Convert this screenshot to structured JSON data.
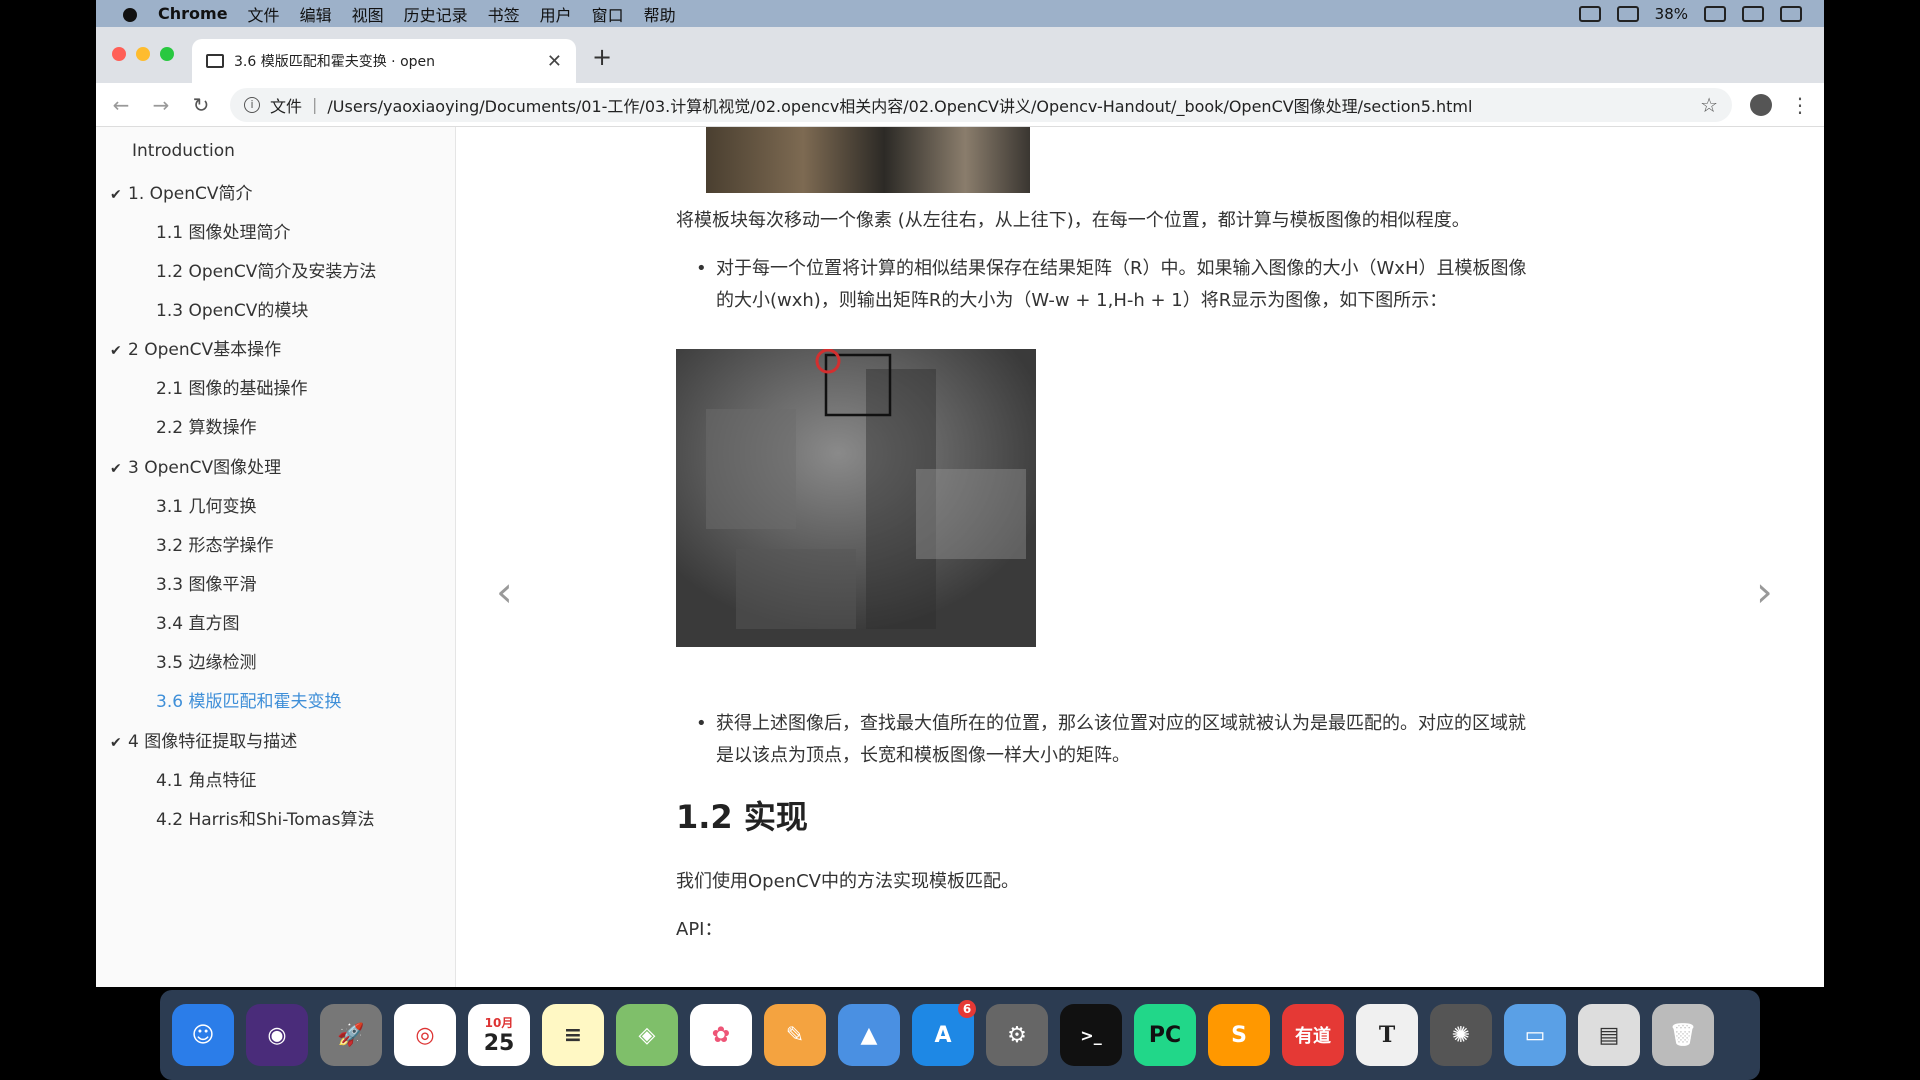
{
  "menubar": {
    "app": "Chrome",
    "items": [
      "文件",
      "编辑",
      "视图",
      "历史记录",
      "书签",
      "用户",
      "窗口",
      "帮助"
    ],
    "battery": "38%"
  },
  "browser": {
    "tab_title": "3.6 模版匹配和霍夫变换 · open",
    "url_prefix": "文件",
    "url": "/Users/yaoxiaoying/Documents/01-工作/03.计算机视觉/02.opencv相关内容/02.OpenCV讲义/Opencv-Handout/_book/OpenCV图像处理/section5.html"
  },
  "sidebar": {
    "items": [
      {
        "label": "Introduction"
      },
      {
        "label": "1. OpenCV简介",
        "expanded": true
      },
      {
        "label": "1.1 图像处理简介"
      },
      {
        "label": "1.2 OpenCV简介及安装方法"
      },
      {
        "label": "1.3 OpenCV的模块"
      },
      {
        "label": "2 OpenCV基本操作",
        "expanded": true
      },
      {
        "label": "2.1 图像的基础操作"
      },
      {
        "label": "2.2 算数操作"
      },
      {
        "label": "3 OpenCV图像处理",
        "expanded": true
      },
      {
        "label": "3.1 几何变换"
      },
      {
        "label": "3.2 形态学操作"
      },
      {
        "label": "3.3 图像平滑"
      },
      {
        "label": "3.4 直方图"
      },
      {
        "label": "3.5 边缘检测"
      },
      {
        "label": "3.6 模版匹配和霍夫变换",
        "active": true
      },
      {
        "label": "4 图像特征提取与描述",
        "expanded": true
      },
      {
        "label": "4.1 角点特征"
      },
      {
        "label": "4.2 Harris和Shi-Tomas算法"
      }
    ]
  },
  "main": {
    "p1": "将模板块每次移动一个像素 (从左往右，从上往下)，在每一个位置，都计算与模板图像的相似程度。",
    "b1_line1": "对于每一个位置将计算的相似结果保存在结果矩阵（R）中。如果输入图像的大小（WxH）且模板图像",
    "b1_line2": "的大小(wxh)，则输出矩阵R的大小为（W-w + 1,H-h + 1）将R显示为图像，如下图所示：",
    "b2_line1": "获得上述图像后，查找最大值所在的位置，那么该位置对应的区域就被认为是最匹配的。对应的区域就",
    "b2_line2": "是以该点为顶点，长宽和模板图像一样大小的矩阵。",
    "heading": "1.2 实现",
    "p2": "我们使用OpenCV中的方法实现模板匹配。",
    "p3": "API："
  },
  "dock": {
    "calendar_month": "10月",
    "calendar_day": "25",
    "appstore_badge": "6",
    "pycharm_label": "PC",
    "youdao_label": "有道"
  },
  "colors": {
    "accent": "#3f8fd8",
    "menubar": "#9db1c9"
  }
}
